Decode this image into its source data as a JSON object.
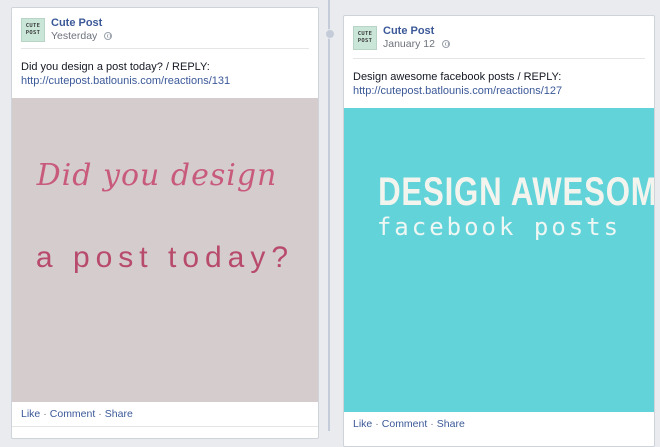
{
  "posts": [
    {
      "page_name": "Cute Post",
      "avatar_text": "CUTE POST",
      "timestamp": "Yesterday",
      "text": "Did you design a post today? / REPLY:",
      "link": "http://cutepost.batlounis.com/reactions/131",
      "image_line1": "Did you design",
      "image_line2": "a post today?",
      "image_bg": "#d5cccd",
      "image_color": "#c85a7c",
      "actions": [
        "Like",
        "Comment",
        "Share"
      ]
    },
    {
      "page_name": "Cute Post",
      "avatar_text": "CUTE POST",
      "timestamp": "January 12",
      "text": "Design awesome facebook posts / REPLY:",
      "link": "http://cutepost.batlounis.com/reactions/127",
      "image_line1": "DESIGN AWESOME",
      "image_line2": "facebook posts",
      "image_bg": "#62d3d8",
      "image_color": "#f4f4ef",
      "actions": [
        "Like",
        "Comment",
        "Share"
      ]
    }
  ],
  "colors": {
    "link": "#3b5998",
    "background": "#e9ebee",
    "meta_text": "#6d727c"
  }
}
